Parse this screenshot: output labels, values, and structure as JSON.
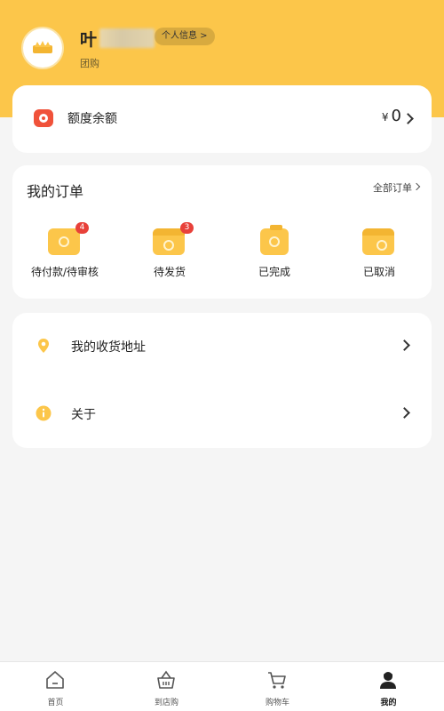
{
  "profile": {
    "name": "叶",
    "info_pill": "个人信息 >",
    "subtitle": "团购"
  },
  "balance": {
    "label": "额度余额",
    "currency": "¥",
    "value": "0"
  },
  "orders": {
    "title": "我的订单",
    "all_label": "全部订单",
    "items": [
      {
        "label": "待付款/待审核",
        "badge": "4",
        "icon": "wallet-icon"
      },
      {
        "label": "待发货",
        "badge": "3",
        "icon": "box-icon"
      },
      {
        "label": "已完成",
        "badge": "",
        "icon": "clipboard-check-icon"
      },
      {
        "label": "已取消",
        "badge": "",
        "icon": "card-cancel-icon"
      }
    ]
  },
  "menu": {
    "address_label": "我的收货地址",
    "about_label": "关于"
  },
  "tabbar": {
    "items": [
      {
        "label": "首页",
        "icon": "home-icon"
      },
      {
        "label": "到店购",
        "icon": "basket-icon"
      },
      {
        "label": "购物车",
        "icon": "cart-icon"
      },
      {
        "label": "我的",
        "icon": "user-icon",
        "active": true
      }
    ]
  },
  "colors": {
    "accent": "#fcc64a",
    "badge": "#e8413a",
    "balance_icon": "#f0523a",
    "background": "#f5f5f5"
  }
}
